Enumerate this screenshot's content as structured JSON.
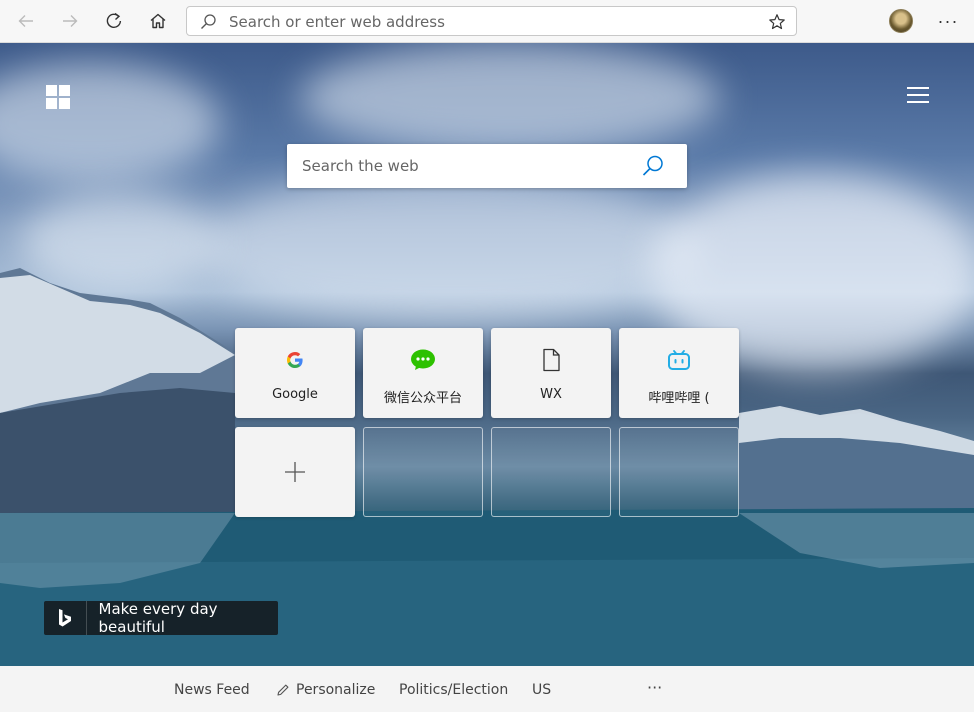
{
  "toolbar": {
    "back_icon": "arrow-left-icon",
    "forward_icon": "arrow-right-icon",
    "refresh_icon": "refresh-icon",
    "home_icon": "home-icon",
    "address_placeholder": "Search or enter web address",
    "favorite_icon": "star-icon",
    "more_label": "···"
  },
  "page": {
    "web_search_placeholder": "Search the web",
    "quick_links": [
      {
        "label": "Google",
        "icon": "google-icon"
      },
      {
        "label": "微信公众平台",
        "icon": "wechat-icon"
      },
      {
        "label": "WX",
        "icon": "document-icon"
      },
      {
        "label": "哔哩哔哩 (",
        "icon": "bilibili-icon"
      }
    ],
    "add_tile_icon": "plus-icon",
    "bing_banner": "Make every day beautiful"
  },
  "newsbar": {
    "news_feed": "News Feed",
    "personalize": "Personalize",
    "politics": "Politics/Election",
    "region": "US",
    "more": "···"
  },
  "colors": {
    "accent": "#0078d4",
    "google_blue": "#4285f4",
    "wechat_green": "#2dc100",
    "bilibili_blue": "#23ade5"
  }
}
